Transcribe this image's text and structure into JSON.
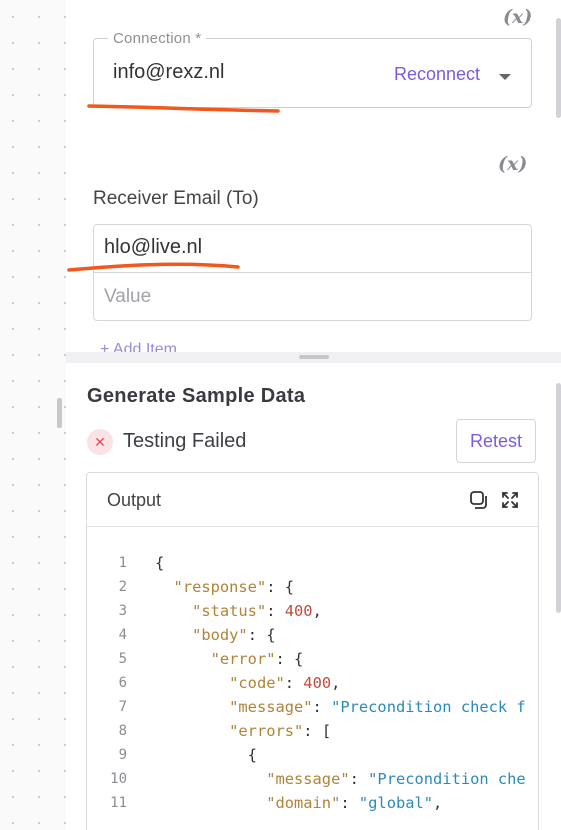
{
  "connection": {
    "legend": "Connection *",
    "value": "info@rexz.nl",
    "reconnect_label": "Reconnect"
  },
  "variable_icon": "(x)",
  "receiver": {
    "label": "Receiver Email (To)",
    "items": [
      "hlo@live.nl"
    ],
    "placeholder": "Value",
    "add_item_label": "+ Add Item"
  },
  "sample": {
    "title": "Generate Sample Data",
    "status_icon": "x-circle-icon",
    "status_text": "Testing Failed",
    "retest_label": "Retest",
    "output_title": "Output",
    "code_lines": [
      [
        {
          "t": "p",
          "v": "{"
        }
      ],
      [
        {
          "t": "p",
          "v": "  "
        },
        {
          "t": "key",
          "v": "\"response\""
        },
        {
          "t": "p",
          "v": ": {"
        }
      ],
      [
        {
          "t": "p",
          "v": "    "
        },
        {
          "t": "key",
          "v": "\"status\""
        },
        {
          "t": "p",
          "v": ": "
        },
        {
          "t": "num",
          "v": "400"
        },
        {
          "t": "p",
          "v": ","
        }
      ],
      [
        {
          "t": "p",
          "v": "    "
        },
        {
          "t": "key",
          "v": "\"body\""
        },
        {
          "t": "p",
          "v": ": {"
        }
      ],
      [
        {
          "t": "p",
          "v": "      "
        },
        {
          "t": "key",
          "v": "\"error\""
        },
        {
          "t": "p",
          "v": ": {"
        }
      ],
      [
        {
          "t": "p",
          "v": "        "
        },
        {
          "t": "key",
          "v": "\"code\""
        },
        {
          "t": "p",
          "v": ": "
        },
        {
          "t": "num",
          "v": "400"
        },
        {
          "t": "p",
          "v": ","
        }
      ],
      [
        {
          "t": "p",
          "v": "        "
        },
        {
          "t": "key",
          "v": "\"message\""
        },
        {
          "t": "p",
          "v": ": "
        },
        {
          "t": "str",
          "v": "\"Precondition check f"
        }
      ],
      [
        {
          "t": "p",
          "v": "        "
        },
        {
          "t": "key",
          "v": "\"errors\""
        },
        {
          "t": "p",
          "v": ": ["
        }
      ],
      [
        {
          "t": "p",
          "v": "          {"
        }
      ],
      [
        {
          "t": "p",
          "v": "            "
        },
        {
          "t": "key",
          "v": "\"message\""
        },
        {
          "t": "p",
          "v": ": "
        },
        {
          "t": "str",
          "v": "\"Precondition che"
        }
      ],
      [
        {
          "t": "p",
          "v": "            "
        },
        {
          "t": "key",
          "v": "\"domain\""
        },
        {
          "t": "p",
          "v": ": "
        },
        {
          "t": "str",
          "v": "\"global\""
        },
        {
          "t": "p",
          "v": ","
        }
      ]
    ]
  },
  "colors": {
    "accent": "#7b5cd6",
    "annotation": "#f2571b",
    "error": "#e44a5a",
    "json_key": "#b0833a",
    "json_number": "#c04b3f",
    "json_string": "#2a8bb8"
  }
}
